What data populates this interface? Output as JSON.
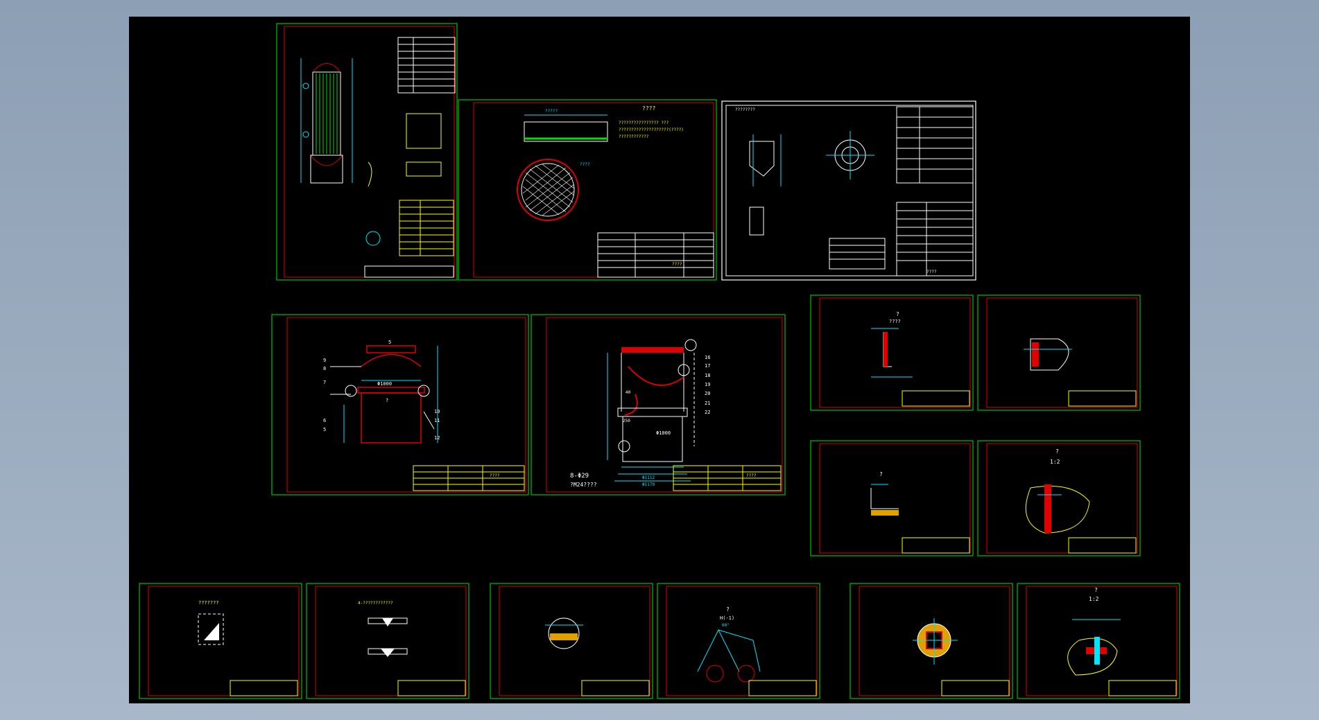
{
  "viewer": {
    "background_color": "#000000",
    "frame_color": "#00c000",
    "border_color": "#e00000",
    "line_colors": {
      "dimension": "#00e5ff",
      "text": "#ffff00",
      "geometry": "#ffffff",
      "hatch": "#e00000"
    }
  },
  "sheets": {
    "s2": {
      "callout": "????",
      "welds": [
        "???????????????? ???",
        "????????????????????(????)",
        "????????????"
      ],
      "dims": [
        "?????",
        "????"
      ],
      "titleblock": "????"
    },
    "s3": {
      "title": "????????",
      "titleblock": "????"
    },
    "s4": {
      "dims": [
        "Φ1000",
        "?",
        "5"
      ],
      "numbers": [
        "9",
        "8",
        "7",
        "6",
        "5",
        "10",
        "11",
        "12"
      ],
      "titleblock": "????"
    },
    "s5": {
      "callout": "8-Φ29",
      "note": "?M24????",
      "dims": [
        "Φ1000",
        "Φ1112",
        "Φ1179",
        "40",
        "250"
      ],
      "numbers": [
        "16",
        "17",
        "18",
        "19",
        "20",
        "21",
        "22"
      ],
      "titleblock": "????"
    },
    "s6": {
      "label": "?",
      "sub": "????"
    },
    "s8": {
      "label": "?"
    },
    "s9": {
      "label": "?",
      "scale": "1:2"
    },
    "s10": {
      "label": "???????"
    },
    "s11": {
      "label": "4-????????????"
    },
    "s13": {
      "label": "?",
      "sub": "H(-1)",
      "angle": "60°"
    },
    "s15": {
      "label": "?",
      "scale": "1:2"
    }
  }
}
